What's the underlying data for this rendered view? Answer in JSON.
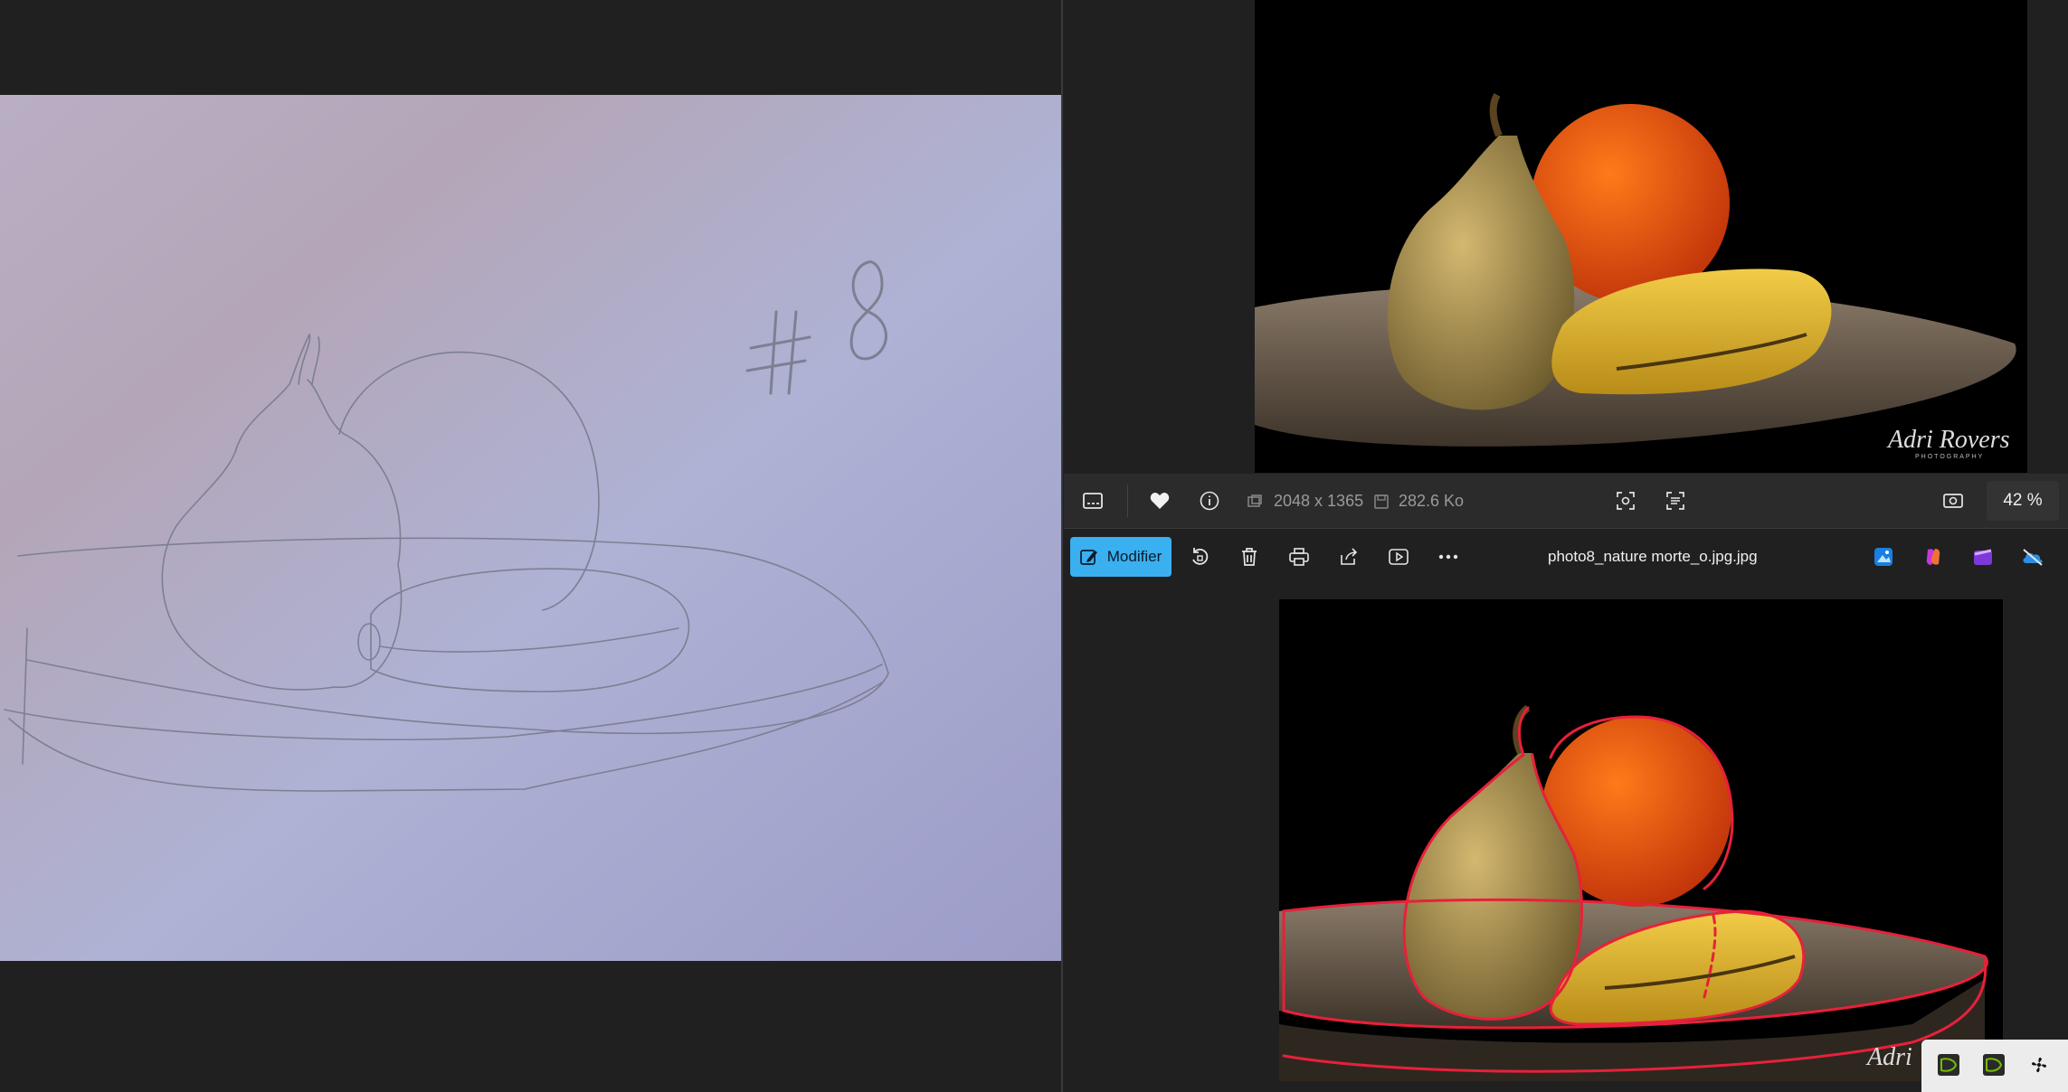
{
  "left_viewer": {
    "sketch_label": "# 8"
  },
  "right_viewer": {
    "top_photo": {
      "watermark_name": "Adri Rovers",
      "watermark_sub": "PHOTOGRAPHY"
    },
    "info_bar": {
      "dimensions": "2048 x 1365",
      "file_size": "282.6 Ko",
      "zoom": "42 %"
    },
    "toolbar": {
      "edit_label": "Modifier",
      "filename": "photo8_nature morte_o.jpg.jpg"
    },
    "bottom_photo": {
      "watermark_name": "Adri",
      "outline_color": "#e8203a"
    }
  },
  "icons": [
    "filmstrip-icon",
    "heart-icon",
    "info-icon",
    "dimensions-icon",
    "save-icon",
    "face-scan-icon",
    "text-scan-icon",
    "fit-screen-icon",
    "edit-icon",
    "rotate-icon",
    "trash-icon",
    "print-icon",
    "share-icon",
    "slideshow-icon",
    "more-icon",
    "photos-app-icon",
    "copilot-icon",
    "clipchamp-icon",
    "onedrive-off-icon",
    "nvidia-icon",
    "nvidia-icon-2",
    "fan-icon"
  ],
  "colors": {
    "accent": "#3ab0f0",
    "background": "#202020"
  }
}
